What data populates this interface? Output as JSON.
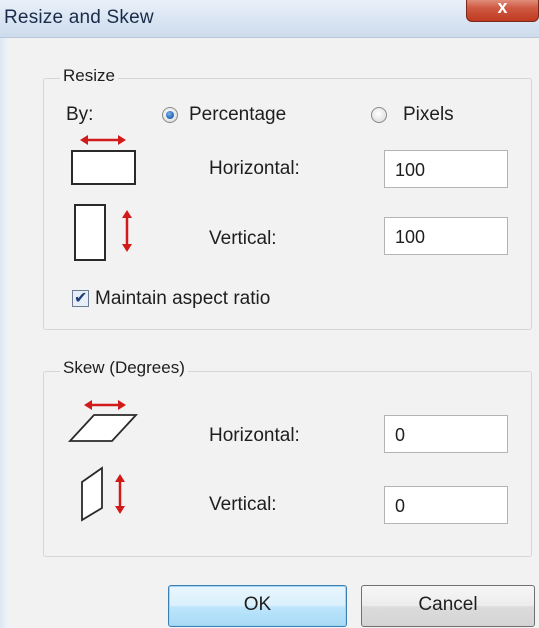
{
  "window": {
    "title": "Resize and Skew",
    "close_glyph": "x"
  },
  "resize": {
    "group_label": "Resize",
    "by_label": "By:",
    "percentage_label": "Percentage",
    "pixels_label": "Pixels",
    "selected_unit": "Percentage",
    "horizontal_label": "Horizontal:",
    "horizontal_value": "100",
    "vertical_label": "Vertical:",
    "vertical_value": "100",
    "maintain_aspect_label": "Maintain aspect ratio",
    "maintain_aspect_checked": true
  },
  "skew": {
    "group_label": "Skew (Degrees)",
    "horizontal_label": "Horizontal:",
    "horizontal_value": "0",
    "vertical_label": "Vertical:",
    "vertical_value": "0"
  },
  "buttons": {
    "ok_label": "OK",
    "cancel_label": "Cancel"
  },
  "icons": {
    "resize_horizontal": "resize-horizontal-icon",
    "resize_vertical": "resize-vertical-icon",
    "skew_horizontal": "skew-horizontal-icon",
    "skew_vertical": "skew-vertical-icon"
  },
  "colors": {
    "arrow_red": "#d11a1a",
    "default_button_border": "#3c7fb1",
    "close_button_red": "#c0391f"
  }
}
